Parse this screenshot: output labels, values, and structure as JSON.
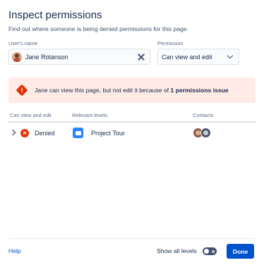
{
  "dialog": {
    "title": "Inspect permissions",
    "subtitle": "Find out where someone is being denied permissions for this page."
  },
  "form": {
    "user_label": "User's name",
    "user_value": "Jane Rotanson",
    "permission_label": "Permission",
    "permission_value": "Can view and edit"
  },
  "banner": {
    "text_prefix": "Jane can view this page, but not edit it because of ",
    "text_bold": "1 permissions issue",
    "icon": "warning-icon"
  },
  "table": {
    "headers": [
      "Can view and edit",
      "Relevant levels",
      "Contacts"
    ],
    "rows": [
      {
        "status": "Denied",
        "level": "Project Tour",
        "status_icon": "denied-icon",
        "level_icon": "space-icon"
      }
    ]
  },
  "footer": {
    "help": "Help",
    "show_all_levels": "Show all levels",
    "show_all_levels_on": false,
    "done": "Done"
  },
  "colors": {
    "primary": "#0052cc",
    "danger": "#de350b",
    "banner_bg": "#ffebe6",
    "space": "#2684ff"
  }
}
